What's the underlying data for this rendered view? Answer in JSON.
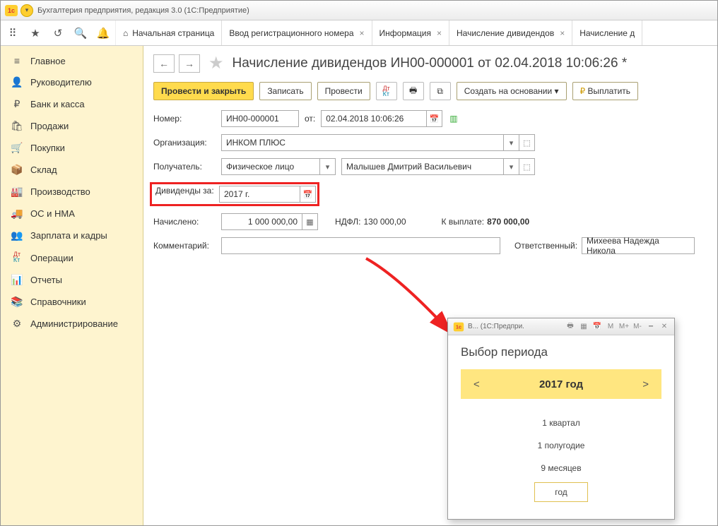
{
  "titlebar": {
    "app_title": "Бухгалтерия предприятия, редакция 3.0  (1С:Предприятие)"
  },
  "tabs": {
    "home": "Начальная страница",
    "items": [
      {
        "label": "Ввод регистрационного номера"
      },
      {
        "label": "Информация"
      },
      {
        "label": "Начисление дивидендов"
      },
      {
        "label": "Начисление д"
      }
    ]
  },
  "sidebar": {
    "items": [
      {
        "icon": "≡",
        "label": "Главное"
      },
      {
        "icon": "👤",
        "label": "Руководителю"
      },
      {
        "icon": "₽",
        "label": "Банк и касса"
      },
      {
        "icon": "🛍",
        "label": "Продажи"
      },
      {
        "icon": "🛒",
        "label": "Покупки"
      },
      {
        "icon": "📦",
        "label": "Склад"
      },
      {
        "icon": "🏭",
        "label": "Производство"
      },
      {
        "icon": "🚚",
        "label": "ОС и НМА"
      },
      {
        "icon": "👥",
        "label": "Зарплата и кадры"
      },
      {
        "icon": "DK",
        "label": "Операции"
      },
      {
        "icon": "📊",
        "label": "Отчеты"
      },
      {
        "icon": "📚",
        "label": "Справочники"
      },
      {
        "icon": "⚙",
        "label": "Администрирование"
      }
    ]
  },
  "page": {
    "title": "Начисление дивидендов ИН00-000001 от 02.04.2018 10:06:26 *",
    "toolbar": {
      "post_close": "Провести и закрыть",
      "write": "Записать",
      "post": "Провести",
      "create_based": "Создать на основании",
      "pay": "Выплатить"
    },
    "fields": {
      "number_lbl": "Номер:",
      "number_val": "ИН00-000001",
      "from_lbl": "от:",
      "from_val": "02.04.2018 10:06:26",
      "org_lbl": "Организация:",
      "org_val": "ИНКОМ ПЛЮС",
      "recipient_lbl": "Получатель:",
      "recipient_type": "Физическое лицо",
      "recipient_name": "Малышев Дмитрий Васильевич",
      "div_for_lbl": "Дивиденды за:",
      "div_for_val": "2017 г.",
      "accrued_lbl": "Начислено:",
      "accrued_val": "1 000 000,00",
      "ndfl_lbl": "НДФЛ:",
      "ndfl_val": "130 000,00",
      "topay_lbl": "К выплате:",
      "topay_val": "870 000,00",
      "comment_lbl": "Комментарий:",
      "responsible_lbl": "Ответственный:",
      "responsible_val": "Михеева Надежда Никола"
    }
  },
  "popup": {
    "winprefix": "В...  (1С:Предпри.",
    "title": "Выбор периода",
    "year": "2017 год",
    "options": [
      "1 квартал",
      "1 полугодие",
      "9 месяцев",
      "год"
    ]
  }
}
